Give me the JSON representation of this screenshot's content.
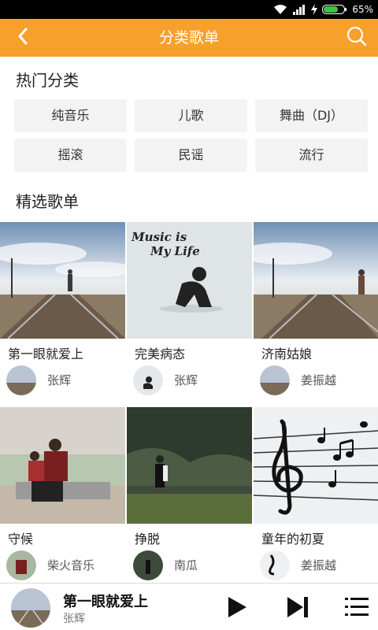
{
  "status": {
    "battery": "65%"
  },
  "header": {
    "title": "分类歌单"
  },
  "sections": {
    "hot_title": "热门分类",
    "featured_title": "精选歌单"
  },
  "categories": [
    "纯音乐",
    "儿歌",
    "舞曲（DJ）",
    "摇滚",
    "民谣",
    "流行"
  ],
  "playlists": [
    {
      "title": "第一眼就爱上",
      "author": "张辉"
    },
    {
      "title": "完美病态",
      "author": "张辉",
      "cover_text_line1": "Music is",
      "cover_text_line2": "My Life"
    },
    {
      "title": "济南姑娘",
      "author": "姜振越"
    },
    {
      "title": "守候",
      "author": "柴火音乐"
    },
    {
      "title": "挣脱",
      "author": "南瓜"
    },
    {
      "title": "童年的初夏",
      "author": "姜振越"
    }
  ],
  "player": {
    "title": "第一眼就爱上",
    "artist": "张辉"
  },
  "colors": {
    "header": "#f7a02b",
    "category_bg": "#f3f3f3"
  },
  "icons": [
    "wifi-icon",
    "signal-icon",
    "charging-icon",
    "battery-icon",
    "back-arrow-icon",
    "search-icon",
    "play-icon",
    "next-icon",
    "playlist-icon"
  ]
}
